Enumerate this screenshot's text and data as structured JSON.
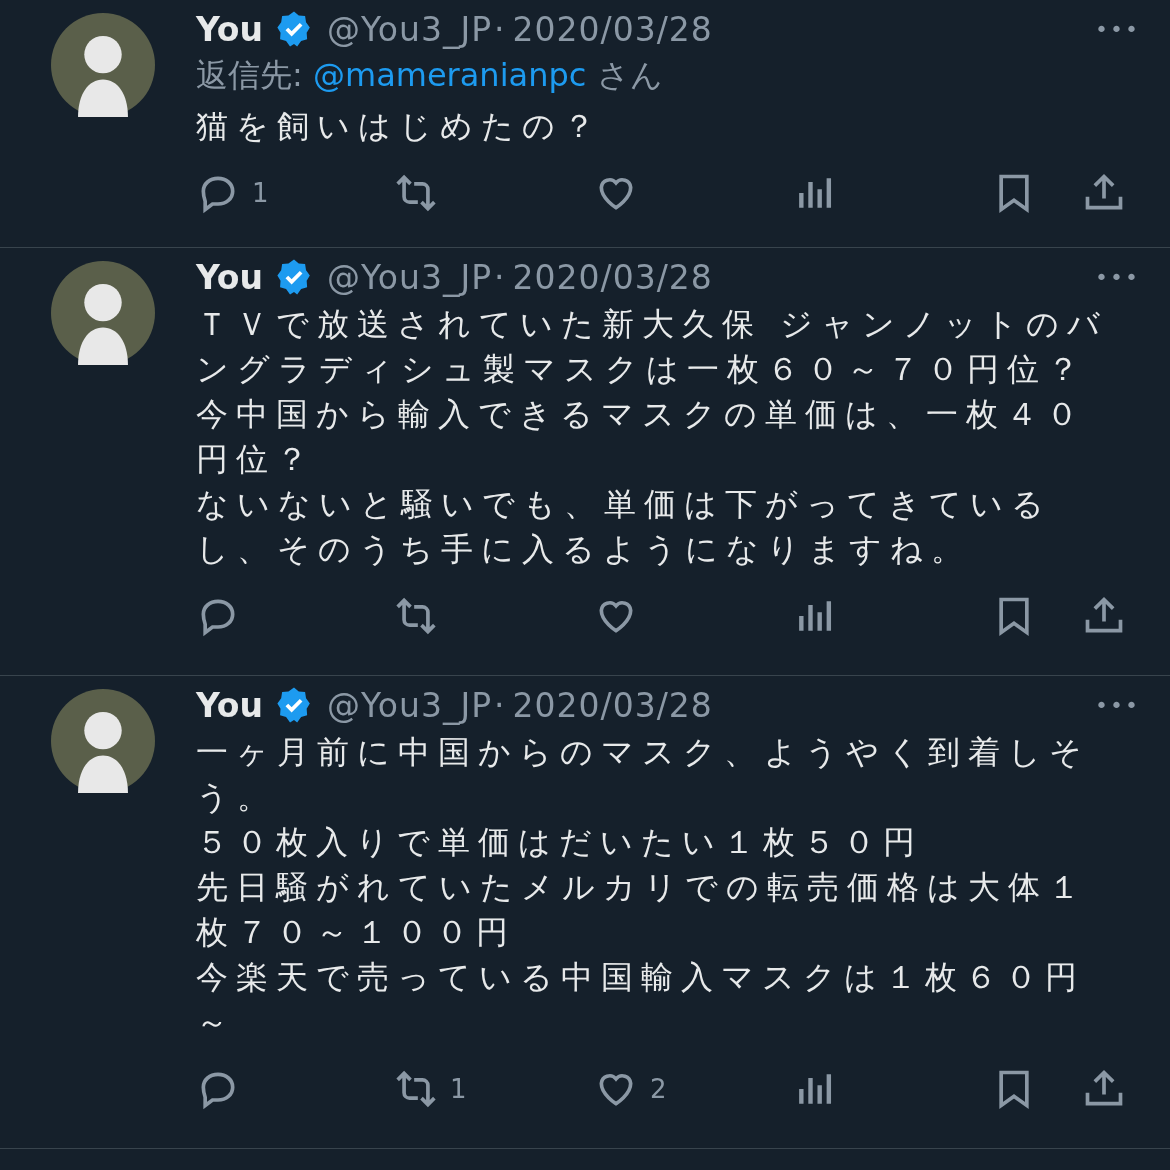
{
  "tweets": [
    {
      "name": "You",
      "verified": true,
      "handle": "@You3_JP",
      "separator": "·",
      "date": "2020/03/28",
      "more": "•••",
      "reply_to": {
        "prefix": "返信先: ",
        "user": "@mameranianpc",
        "suffix": " さん"
      },
      "lines": [
        "猫を飼いはじめたの？"
      ],
      "reply_count": "1"
    },
    {
      "name": "You",
      "verified": true,
      "handle": "@You3_JP",
      "separator": "·",
      "date": "2020/03/28",
      "more": "•••",
      "lines": [
        "ＴＶで放送されていた新大久保 ジャンノットのバ",
        "ングラディシュ製マスクは一枚６０～７０円位？",
        "今中国から輸入できるマスクの単価は、一枚４０",
        "円位？",
        "ないないと騒いでも、単価は下がってきている",
        "し、そのうち手に入るようになりますね。"
      ]
    },
    {
      "name": "You",
      "verified": true,
      "handle": "@You3_JP",
      "separator": "·",
      "date": "2020/03/28",
      "more": "•••",
      "lines": [
        "一ヶ月前に中国からのマスク、ようやく到着しそ",
        "う。",
        "５０枚入りで単価はだいたい１枚５０円",
        "先日騒がれていたメルカリでの転売価格は大体１",
        "枚７０～１００円",
        "今楽天で売っている中国輸入マスクは１枚６０円",
        "～"
      ],
      "retweet_count": "1",
      "like_count": "2"
    }
  ]
}
